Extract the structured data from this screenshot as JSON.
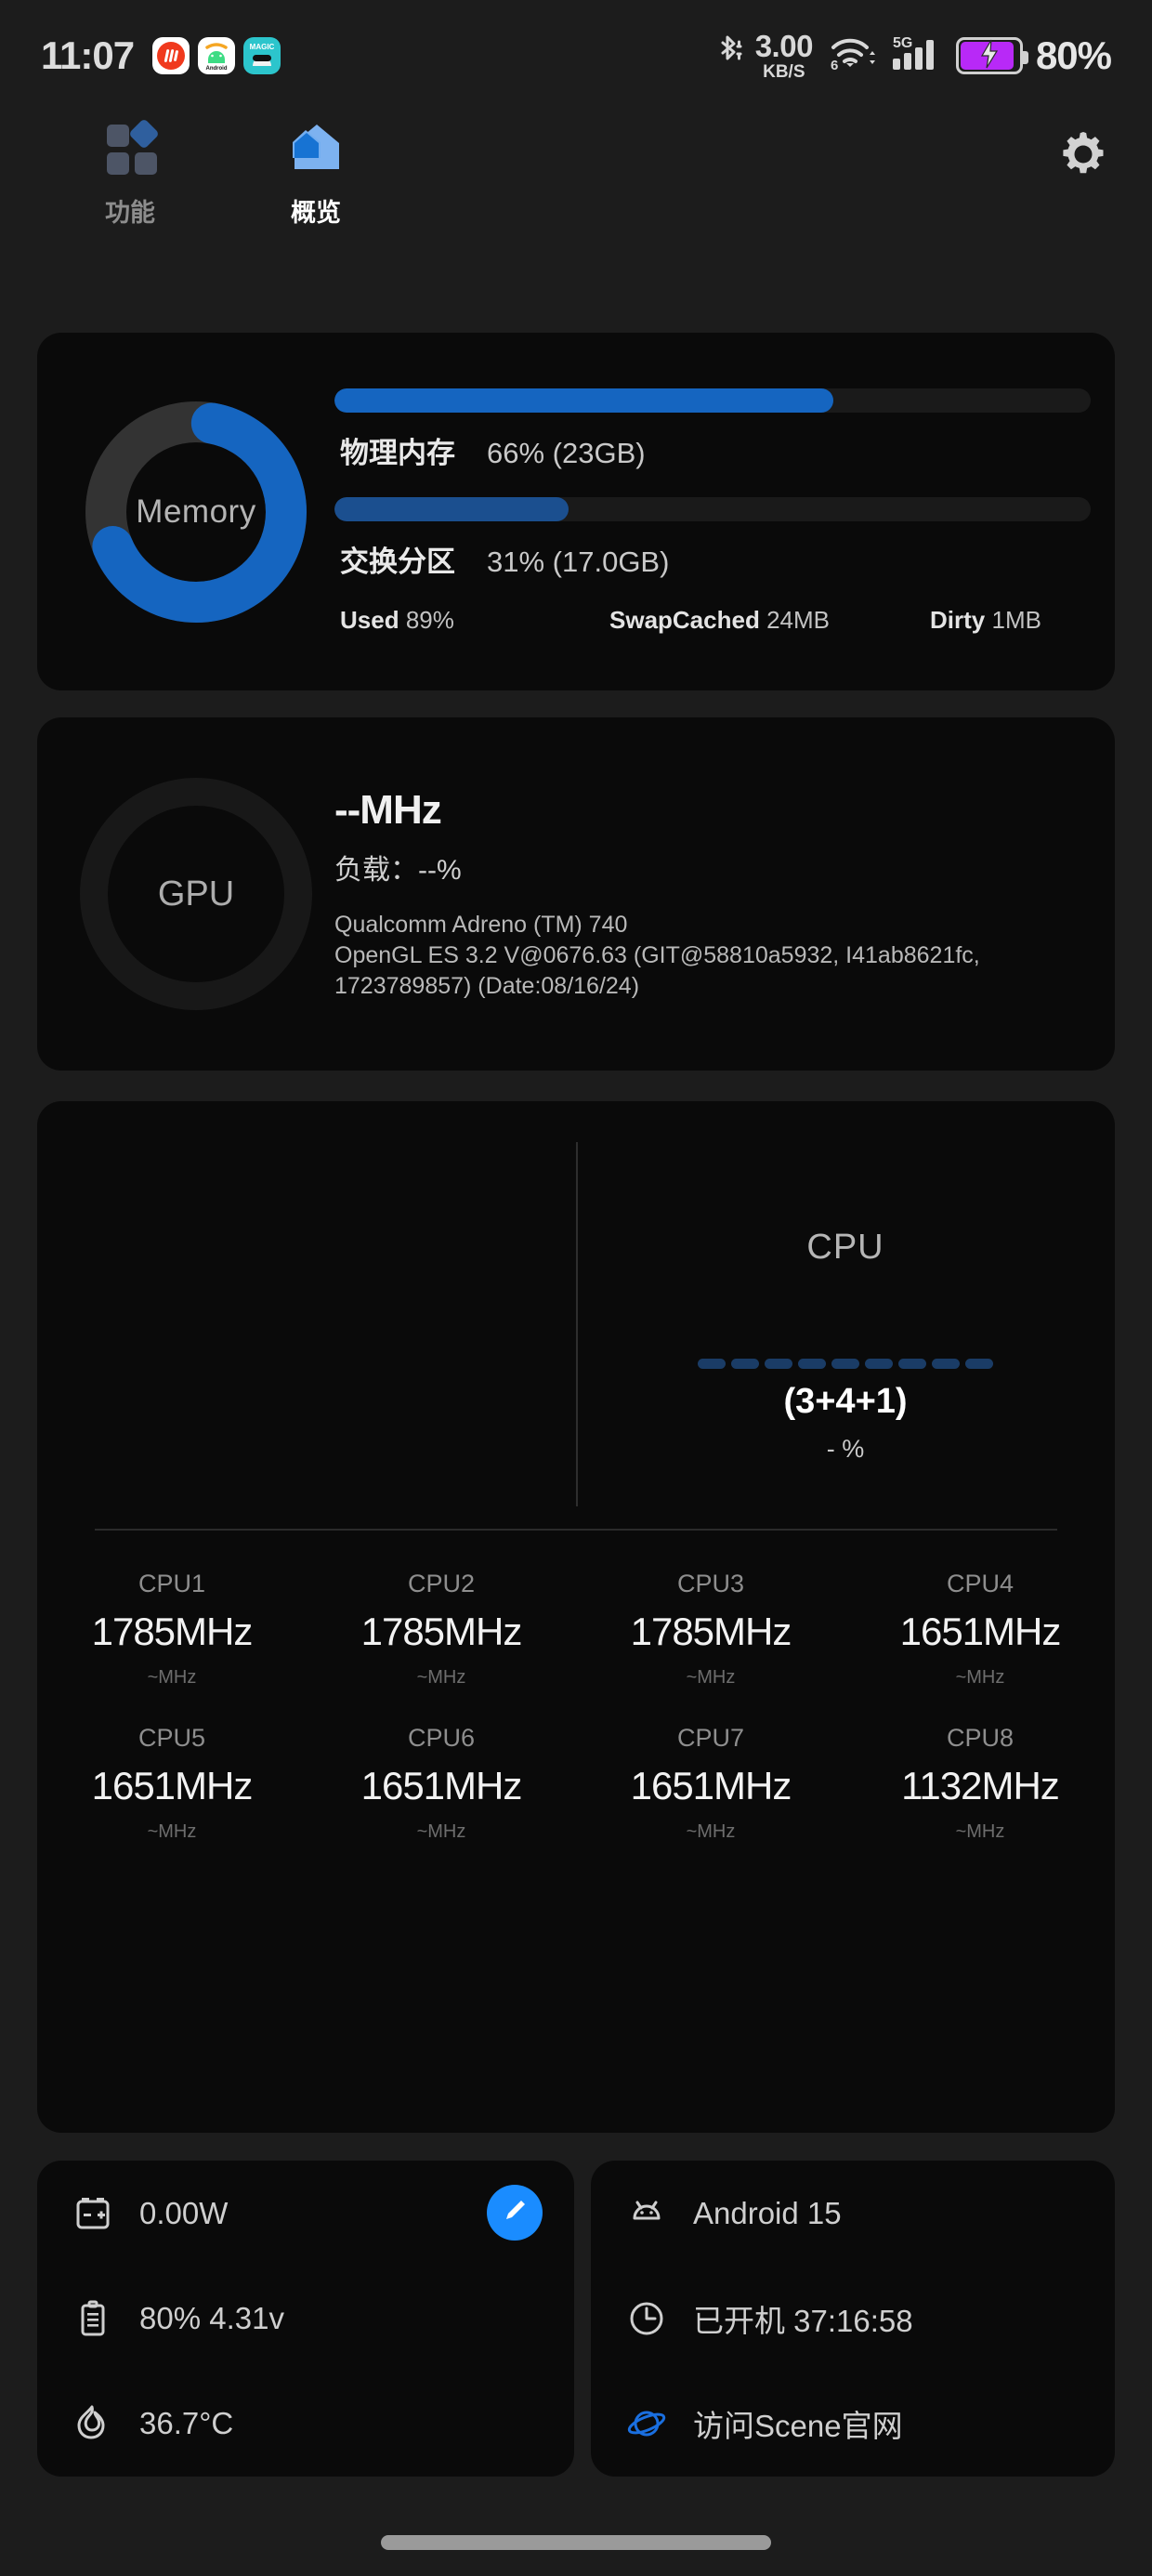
{
  "status_bar": {
    "clock": "11:07",
    "app_icons": [
      "vlc-app-icon",
      "android-app-icon",
      "magic-app-icon"
    ],
    "bluetooth_icon": "bluetooth-icon",
    "net_speed_value": "3.00",
    "net_speed_unit": "KB/S",
    "wifi_icon": "wifi-6-icon",
    "wifi_generation": "6",
    "signal_label": "5G",
    "signal_icon": "cellular-signal-icon",
    "battery_icon": "battery-charging-icon",
    "battery_percent": "80%",
    "battery_color": "#b829f7"
  },
  "tabs": [
    {
      "label": "功能",
      "icon": "modules-grid-icon",
      "active": false
    },
    {
      "label": "概览",
      "icon": "home-overview-icon",
      "active": true
    }
  ],
  "settings_button": {
    "icon": "gear-icon"
  },
  "memory_card": {
    "ring_label": "Memory",
    "ring_percent": 66,
    "ring_color": "#1565c0",
    "bars": [
      {
        "name": "物理内存",
        "value": "66% (23GB)",
        "percent": 66
      },
      {
        "name": "交换分区",
        "value": "31% (17.0GB)",
        "percent": 31
      }
    ],
    "stats": [
      {
        "key": "Used",
        "value": "89%"
      },
      {
        "key": "SwapCached",
        "value": "24MB"
      },
      {
        "key": "Dirty",
        "value": "1MB"
      }
    ]
  },
  "gpu_card": {
    "ring_label": "GPU",
    "frequency": "--MHz",
    "load_label": "负载：",
    "load_value": "--%",
    "renderer": "Qualcomm Adreno (TM) 740",
    "version": "OpenGL ES 3.2 V@0676.63 (GIT@58810a5932, I41ab8621fc, 1723789857) (Date:08/16/24)"
  },
  "cpu_card": {
    "title": "CPU",
    "cluster_layout": "(3+4+1)",
    "load_percent": "- %",
    "dash_count": 9,
    "dash_color": "#1a3c66",
    "cores": [
      {
        "name": "CPU1",
        "freq": "1785MHz",
        "sub": "~MHz"
      },
      {
        "name": "CPU2",
        "freq": "1785MHz",
        "sub": "~MHz"
      },
      {
        "name": "CPU3",
        "freq": "1785MHz",
        "sub": "~MHz"
      },
      {
        "name": "CPU4",
        "freq": "1651MHz",
        "sub": "~MHz"
      },
      {
        "name": "CPU5",
        "freq": "1651MHz",
        "sub": "~MHz"
      },
      {
        "name": "CPU6",
        "freq": "1651MHz",
        "sub": "~MHz"
      },
      {
        "name": "CPU7",
        "freq": "1651MHz",
        "sub": "~MHz"
      },
      {
        "name": "CPU8",
        "freq": "1132MHz",
        "sub": "~MHz"
      }
    ]
  },
  "power_card": {
    "rows": [
      {
        "icon": "battery-power-icon",
        "text": "0.00W"
      },
      {
        "icon": "battery-level-icon",
        "text": "80%  4.31v"
      },
      {
        "icon": "flame-icon",
        "text": "36.7°C"
      }
    ],
    "edit_button": {
      "icon": "pencil-edit-icon",
      "color": "#1a8cff"
    }
  },
  "system_card": {
    "rows": [
      {
        "icon": "android-icon",
        "text": "Android 15"
      },
      {
        "icon": "clock-icon",
        "text": "已开机  37:16:58"
      },
      {
        "icon": "planet-icon",
        "text": "访问Scene官网"
      }
    ]
  },
  "nav_pill": {
    "name": "home-gesture-pill"
  }
}
